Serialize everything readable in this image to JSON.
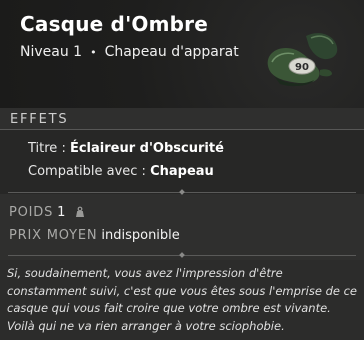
{
  "item": {
    "name": "Casque d'Ombre",
    "level": "Niveau 1",
    "separator": "•",
    "category": "Chapeau d'apparat",
    "image_icon": "shadow-helmet-icon",
    "image_label": "90"
  },
  "effects": {
    "section_title": "EFFETS",
    "lines": [
      {
        "label": "Titre : ",
        "value": "Éclaireur d'Obscurité"
      },
      {
        "label": "Compatible avec : ",
        "value": "Chapeau"
      }
    ]
  },
  "stats": {
    "weight_label": "POIDS",
    "weight_value": "1",
    "weight_icon": "weight-icon",
    "price_label": "PRIX MOYEN",
    "price_value": "indisponible"
  },
  "description": "Si, soudainement, vous avez l'impression d'être constamment suivi, c'est que vous êtes sous l'emprise de ce casque qui vous fait croire que votre ombre est vivante. Voilà qui ne va rien arranger à votre sciophobie.",
  "colors": {
    "background": "#2f2f2e",
    "header_background": "#1e1e1d",
    "item_green": "#3c5438"
  }
}
